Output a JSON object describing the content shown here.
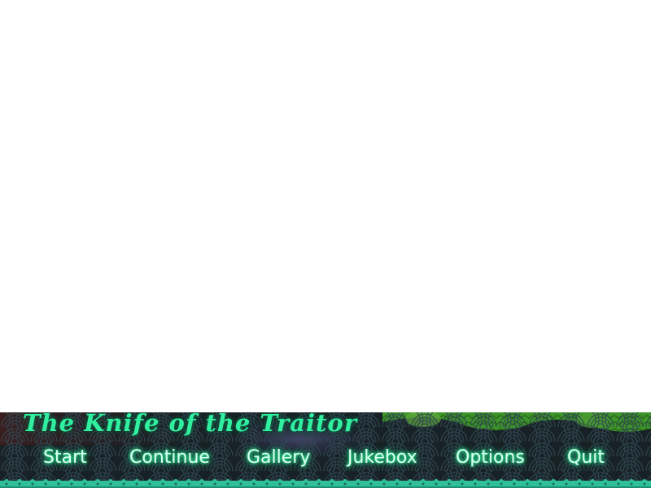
{
  "game": {
    "title": "The Knife of the Traitor"
  },
  "main_menu": {
    "items": [
      {
        "label": "Start"
      },
      {
        "label": "Continue"
      },
      {
        "label": "Gallery"
      },
      {
        "label": "Jukebox"
      },
      {
        "label": "Options"
      },
      {
        "label": "Quit"
      }
    ]
  },
  "colors": {
    "menu_glow": "#2cff9e",
    "title_text": "#30f0a0",
    "strip_background": "#1a2328",
    "trim": "#2fbf9a"
  }
}
